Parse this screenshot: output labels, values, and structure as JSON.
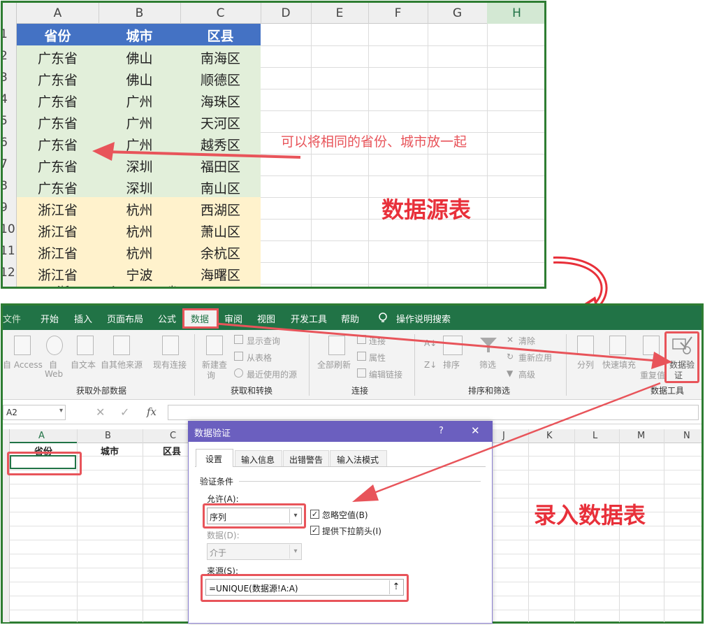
{
  "top_sheet": {
    "col_headers": [
      "A",
      "B",
      "C",
      "D",
      "E",
      "F",
      "G",
      "H"
    ],
    "row_numbers": [
      "1",
      "2",
      "3",
      "4",
      "5",
      "6",
      "7",
      "8",
      "9",
      "10",
      "11",
      "12"
    ],
    "table_header": [
      "省份",
      "城市",
      "区县"
    ],
    "rows": [
      [
        "广东省",
        "佛山",
        "南海区"
      ],
      [
        "广东省",
        "佛山",
        "顺德区"
      ],
      [
        "广东省",
        "广州",
        "海珠区"
      ],
      [
        "广东省",
        "广州",
        "天河区"
      ],
      [
        "广东省",
        "广州",
        "越秀区"
      ],
      [
        "广东省",
        "深圳",
        "福田区"
      ],
      [
        "广东省",
        "深圳",
        "南山区"
      ],
      [
        "浙江省",
        "杭州",
        "西湖区"
      ],
      [
        "浙江省",
        "杭州",
        "萧山区"
      ],
      [
        "浙江省",
        "杭州",
        "余杭区"
      ],
      [
        "浙江省",
        "宁波",
        "海曙区"
      ]
    ],
    "colors": {
      "header_bg": "#4472c4",
      "guangdong_bg": "#e2efda",
      "zhejiang_bg": "#fff2cc"
    }
  },
  "annotations": {
    "note": "可以将相同的省份、城市放一起",
    "source_title": "数据源表",
    "entry_title": "录入数据表",
    "accent": "#e8545a"
  },
  "ribbon": {
    "tabs": [
      "文件",
      "开始",
      "插入",
      "页面布局",
      "公式",
      "数据",
      "审阅",
      "视图",
      "开发工具",
      "帮助",
      "操作说明搜索"
    ],
    "active_tab": "数据",
    "groups": {
      "external": {
        "label": "获取外部数据",
        "items": [
          "自 Access",
          "自",
          "Web",
          "自文本",
          "自其他来源",
          "现有连接"
        ]
      },
      "transform": {
        "label": "获取和转换",
        "new_query": [
          "新建查",
          "询"
        ],
        "items": [
          "显示查询",
          "从表格",
          "最近使用的源"
        ]
      },
      "connections": {
        "label": "连接",
        "refresh": "全部刷新",
        "items": [
          "连接",
          "属性",
          "编辑链接"
        ]
      },
      "sort_filter": {
        "label": "排序和筛选",
        "sort": "排序",
        "filter": "筛选",
        "items": [
          "清除",
          "重新应用",
          "高级"
        ]
      },
      "data_tools": {
        "label": "数据工具",
        "split": "分列",
        "flash_fill": "快速填充",
        "dup": "重复值",
        "validation": [
          "数据验",
          "证"
        ]
      }
    },
    "brand_color": "#217346"
  },
  "formula_bar": {
    "name_box": "A2",
    "fx": "fx",
    "cancel": "✕",
    "confirm": "✓"
  },
  "bottom_sheet": {
    "col_headers": [
      "A",
      "B",
      "C",
      "J",
      "K",
      "L",
      "M",
      "N"
    ],
    "header_cells": [
      "省份",
      "城市",
      "区县"
    ]
  },
  "dialog": {
    "title": "数据验证",
    "help": "?",
    "close": "✕",
    "tabs": [
      "设置",
      "输入信息",
      "出错警告",
      "输入法模式"
    ],
    "section": "验证条件",
    "allow_label": "允许(A):",
    "allow_value": "序列",
    "ignore_blank": "忽略空值(B)",
    "dropdown": "提供下拉箭头(I)",
    "data_label": "数据(D):",
    "data_value": "介于",
    "source_label": "来源(S):",
    "source_value": "=UNIQUE(数据源!A:A)",
    "title_color": "#6b5fbf"
  }
}
